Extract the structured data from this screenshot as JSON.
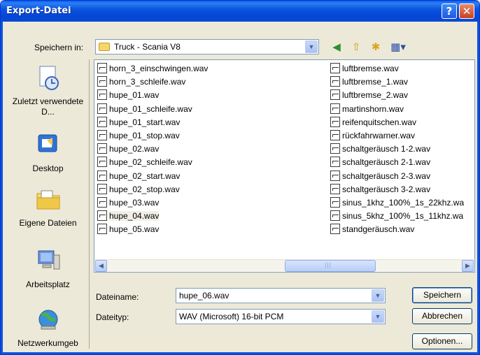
{
  "window": {
    "title": "Export-Datei"
  },
  "toolbar": {
    "save_in_label": "Speichern in:",
    "location": "Truck - Scania V8"
  },
  "places": [
    {
      "label": "Zuletzt verwendete D...",
      "icon": "recent-documents-icon"
    },
    {
      "label": "Desktop",
      "icon": "desktop-icon"
    },
    {
      "label": "Eigene Dateien",
      "icon": "my-documents-icon"
    },
    {
      "label": "Arbeitsplatz",
      "icon": "my-computer-icon"
    },
    {
      "label": "Netzwerkumgeb",
      "icon": "network-icon"
    }
  ],
  "files_col1": [
    "horn_3_einschwingen.wav",
    "horn_3_schleife.wav",
    "hupe_01.wav",
    "hupe_01_schleife.wav",
    "hupe_01_start.wav",
    "hupe_01_stop.wav",
    "hupe_02.wav",
    "hupe_02_schleife.wav",
    "hupe_02_start.wav",
    "hupe_02_stop.wav",
    "hupe_03.wav",
    "hupe_04.wav",
    "hupe_05.wav"
  ],
  "files_col2": [
    "luftbremse.wav",
    "luftbremse_1.wav",
    "luftbremse_2.wav",
    "martinshorn.wav",
    "reifenquitschen.wav",
    "rückfahrwarner.wav",
    "schaltgeräusch 1-2.wav",
    "schaltgeräusch 2-1.wav",
    "schaltgeräusch 2-3.wav",
    "schaltgeräusch 3-2.wav",
    "sinus_1khz_100%_1s_22khz.wa",
    "sinus_5khz_100%_1s_11khz.wa",
    "standgeräusch.wav"
  ],
  "selected_file": "hupe_04.wav",
  "form": {
    "filename_label": "Dateiname:",
    "filename_value": "hupe_06.wav",
    "filetype_label": "Dateityp:",
    "filetype_value": "WAV (Microsoft) 16-bit PCM"
  },
  "buttons": {
    "save": "Speichern",
    "cancel": "Abbrechen",
    "options": "Optionen..."
  },
  "colors": {
    "title_bar": "#0b55de",
    "dialog_bg": "#ece9d8",
    "field_border": "#7f9db9"
  }
}
